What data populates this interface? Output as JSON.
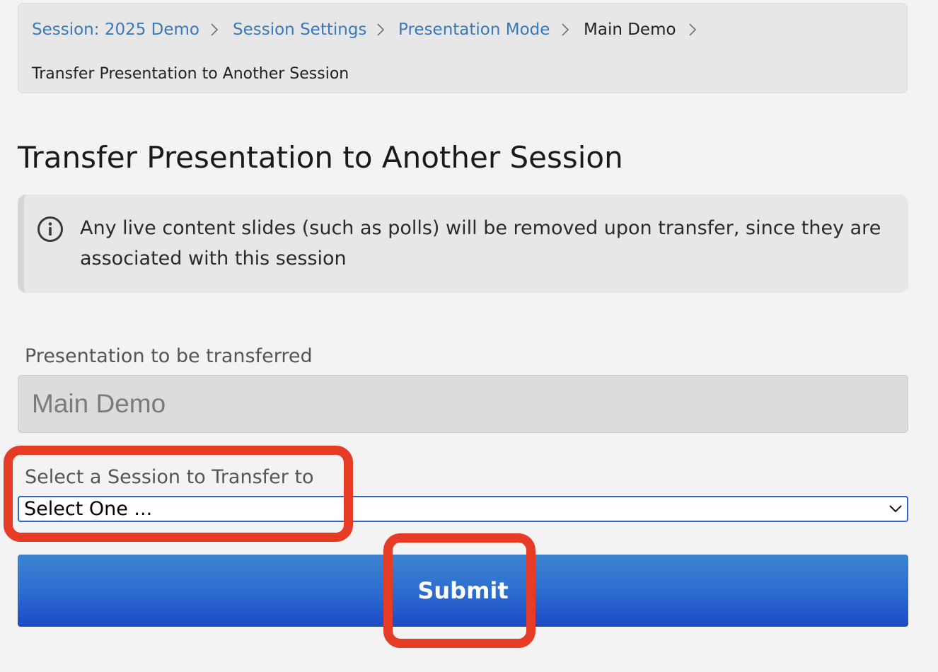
{
  "breadcrumb": {
    "items": [
      {
        "label": "Session: 2025 Demo",
        "is_link": true
      },
      {
        "label": "Session Settings",
        "is_link": true
      },
      {
        "label": "Presentation Mode",
        "is_link": true
      },
      {
        "label": "Main Demo",
        "is_link": false
      },
      {
        "label": "Transfer Presentation to Another Session",
        "is_link": false
      }
    ],
    "separator_icon": "chevron-right-icon"
  },
  "page": {
    "title": "Transfer Presentation to Another Session"
  },
  "callout": {
    "icon": "info-icon",
    "text": "Any live content slides (such as polls) will be removed upon transfer, since they are associated with this session"
  },
  "form": {
    "presentation_label": "Presentation to be transferred",
    "presentation_value": "Main Demo",
    "session_label": "Select a Session to Transfer to",
    "session_selected": "Select One ...",
    "session_icon": "chevron-down-icon",
    "submit_label": "Submit"
  },
  "annotations": {
    "color": "#e63b25"
  },
  "colors": {
    "link": "#3a79b8",
    "button_top": "#3d84d0",
    "button_bottom": "#1d49c8",
    "select_border": "#2e63c9"
  }
}
